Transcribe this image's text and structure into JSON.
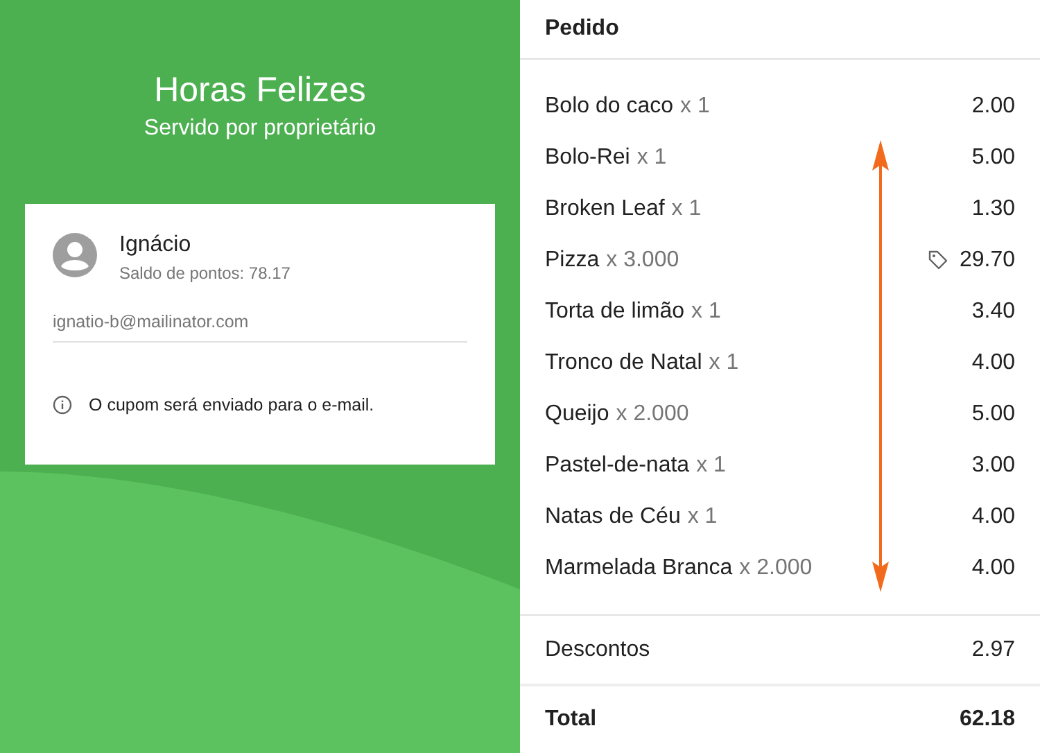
{
  "promo": {
    "title": "Horas Felizes",
    "subtitle": "Servido por proprietário"
  },
  "customer": {
    "name": "Ignácio",
    "points": "Saldo de pontos: 78.17",
    "email": "ignatio-b@mailinator.com",
    "note": "O cupom será enviado para o e-mail."
  },
  "order": {
    "title": "Pedido",
    "items": [
      {
        "name": "Bolo do caco",
        "qty": "x 1",
        "price": "2.00",
        "discounted": false
      },
      {
        "name": "Bolo-Rei",
        "qty": "x 1",
        "price": "5.00",
        "discounted": false
      },
      {
        "name": "Broken Leaf",
        "qty": "x 1",
        "price": "1.30",
        "discounted": false
      },
      {
        "name": "Pizza",
        "qty": "x 3.000",
        "price": "29.70",
        "discounted": true
      },
      {
        "name": "Torta de limão",
        "qty": "x 1",
        "price": "3.40",
        "discounted": false
      },
      {
        "name": "Tronco de Natal",
        "qty": "x 1",
        "price": "4.00",
        "discounted": false
      },
      {
        "name": "Queijo",
        "qty": "x 2.000",
        "price": "5.00",
        "discounted": false
      },
      {
        "name": "Pastel-de-nata",
        "qty": "x 1",
        "price": "3.00",
        "discounted": false
      },
      {
        "name": "Natas de Céu",
        "qty": "x 1",
        "price": "4.00",
        "discounted": false
      },
      {
        "name": "Marmelada Branca",
        "qty": "x 2.000",
        "price": "4.00",
        "discounted": false
      }
    ],
    "discounts": {
      "label": "Descontos",
      "value": "2.97"
    },
    "total": {
      "label": "Total",
      "value": "62.18"
    }
  }
}
